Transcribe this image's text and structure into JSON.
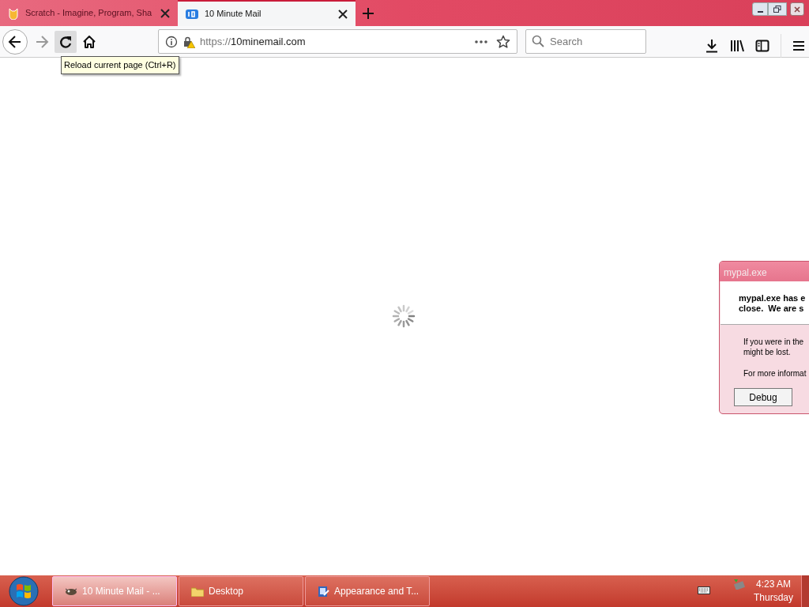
{
  "tabs": [
    {
      "title": "Scratch - Imagine, Program, Sha",
      "kind": "scratch",
      "selected": false
    },
    {
      "title": "10 Minute Mail",
      "kind": "mail",
      "selected": true
    }
  ],
  "nav_buttons": [
    {
      "kind": "back",
      "disabled": false,
      "hovered": false
    },
    {
      "kind": "forward",
      "disabled": true,
      "hovered": false
    },
    {
      "kind": "reload",
      "disabled": false,
      "hovered": true
    },
    {
      "kind": "home",
      "disabled": false,
      "hovered": false
    }
  ],
  "tooltip": "Reload current page (Ctrl+R)",
  "address_bar": {
    "scheme": "https://",
    "host": "10minemail.com"
  },
  "search": {
    "placeholder": "Search"
  },
  "dialog": {
    "title": "mypal.exe",
    "heading_lines": [
      "mypal.exe has e",
      "close.  We are s"
    ],
    "body_lines": [
      "If you were in the",
      "might be lost."
    ],
    "info_line": "For more informat",
    "button": "Debug"
  },
  "taskbar": {
    "items": [
      {
        "label": "10 Minute Mail - ...",
        "kind": "browser",
        "selected": true
      },
      {
        "label": "Desktop",
        "kind": "folder",
        "selected": false
      },
      {
        "label": "Appearance and T...",
        "kind": "settings",
        "selected": false
      }
    ],
    "time": "4:23 AM",
    "day": "Thursday"
  }
}
